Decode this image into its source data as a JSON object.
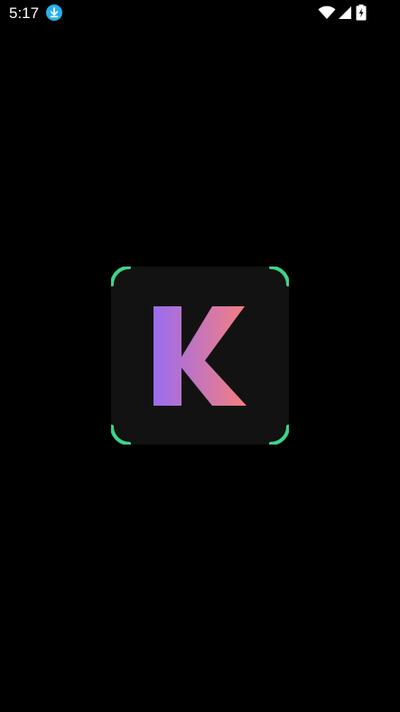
{
  "status_bar": {
    "time": "5:17",
    "download_icon": "download-icon",
    "wifi_icon": "wifi-icon",
    "signal_icon": "cellular-signal-icon",
    "battery_icon": "battery-charging-icon",
    "accent_color": "#26b0f0"
  },
  "splash": {
    "logo_letter": "K",
    "logo_background": "#121212",
    "corner_accent": "#3fd18a",
    "gradient_start": "#9a6cf0",
    "gradient_end": "#f57f7f"
  }
}
